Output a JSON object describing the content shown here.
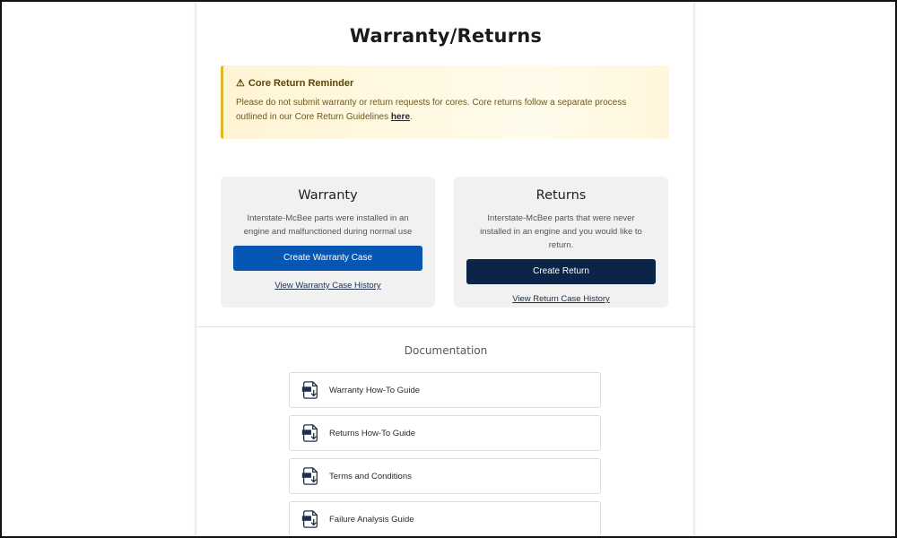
{
  "page": {
    "title": "Warranty/Returns"
  },
  "alert": {
    "icon": "warning-triangle-icon",
    "heading": "Core Return Reminder",
    "body": "Please do not submit warranty or return requests for cores. Core returns follow a separate process outlined in our Core Return Guidelines ",
    "link_text": "here",
    "trailing": "."
  },
  "cards": {
    "warranty": {
      "title": "Warranty",
      "description": "Interstate-McBee parts were installed in an engine and malfunctioned during normal use",
      "button": "Create Warranty Case",
      "link": "View Warranty Case History"
    },
    "returns": {
      "title": "Returns",
      "description": "Interstate-McBee parts that were never installed in an engine and you would like to return.",
      "button": "Create Return",
      "link": "View Return Case History"
    }
  },
  "documentation": {
    "title": "Documentation",
    "items": [
      {
        "label": "Warranty How-To Guide",
        "icon": "pdf-download-icon"
      },
      {
        "label": "Returns How-To Guide",
        "icon": "pdf-download-icon"
      },
      {
        "label": "Terms and Conditions",
        "icon": "pdf-download-icon"
      },
      {
        "label": "Failure Analysis Guide",
        "icon": "pdf-download-icon"
      }
    ]
  },
  "colors": {
    "warranty_button": "#0656b3",
    "returns_button": "#0b2448",
    "alert_accent": "#e2b62a",
    "alert_background": "#fff4d4"
  }
}
